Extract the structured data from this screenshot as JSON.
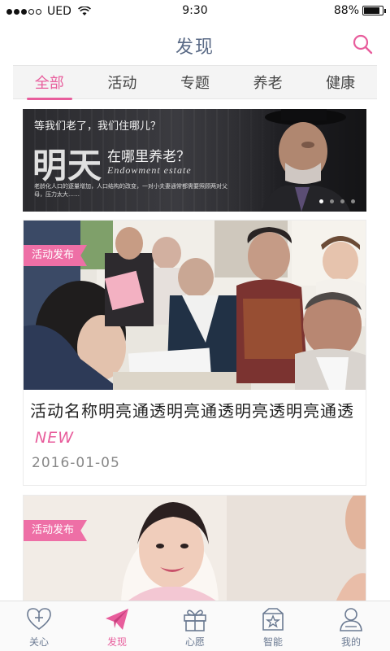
{
  "status_bar": {
    "carrier": "UED",
    "time": "9:30",
    "battery_percent": "88%",
    "battery_level": 0.88
  },
  "nav": {
    "title": "发现",
    "search_icon": "search-icon",
    "accent_color": "#e85d9c"
  },
  "tabs": [
    {
      "label": "全部",
      "active": true
    },
    {
      "label": "活动",
      "active": false
    },
    {
      "label": "专题",
      "active": false
    },
    {
      "label": "养老",
      "active": false
    },
    {
      "label": "健康",
      "active": false
    }
  ],
  "banner": {
    "headline": "等我们老了，我们住哪儿？",
    "big_text": "明天",
    "subtitle": "在哪里养老？",
    "english": "Endowment estate",
    "description": "老龄化人口的逐量增加，人口结构的改变，一对小夫妻通常都需要照顾两对父母，压力太大……",
    "page_count": 4,
    "active_page": 0
  },
  "cards": [
    {
      "tag": "活动发布",
      "title": "活动名称明亮通透明亮通透明亮透明亮通透",
      "badge": "NEW",
      "date": "2016-01-05"
    },
    {
      "tag": "活动发布"
    }
  ],
  "tabbar": [
    {
      "label": "关心",
      "icon": "heart-plus-icon",
      "active": false
    },
    {
      "label": "发现",
      "icon": "paper-plane-icon",
      "active": true
    },
    {
      "label": "心愿",
      "icon": "gift-icon",
      "active": false
    },
    {
      "label": "智能",
      "icon": "smart-box-icon",
      "active": false
    },
    {
      "label": "我的",
      "icon": "user-icon",
      "active": false
    }
  ]
}
